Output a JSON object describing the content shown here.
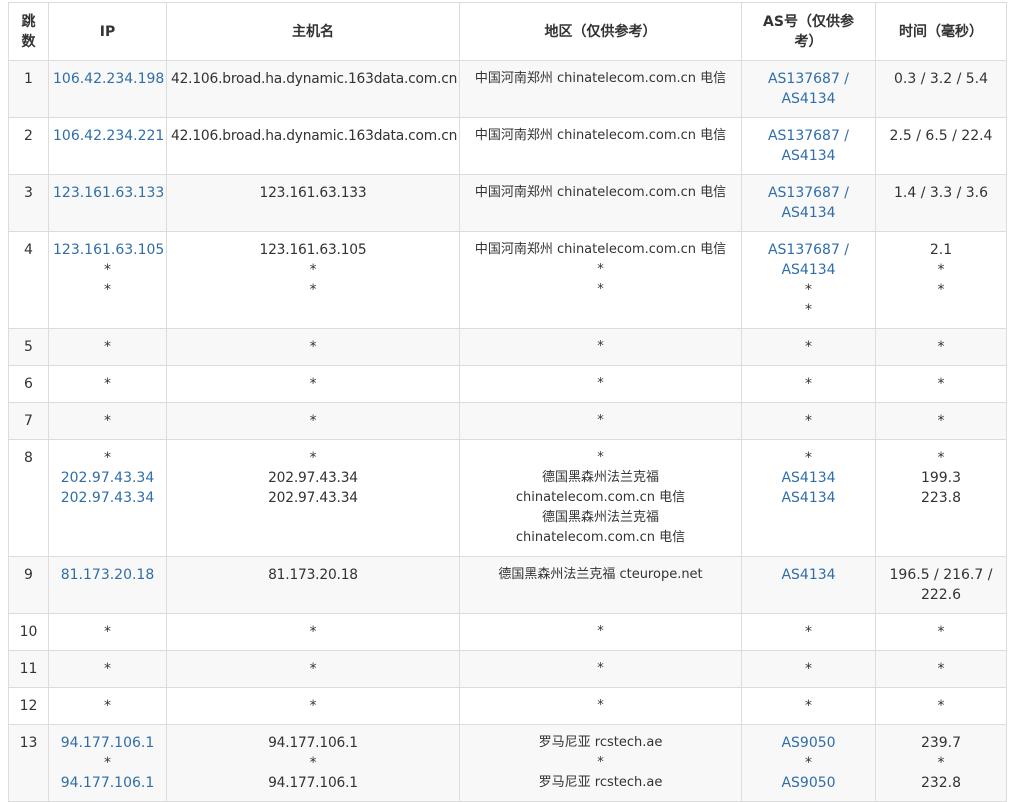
{
  "headers": {
    "hop": "跳数",
    "ip": "IP",
    "host": "主机名",
    "region": "地区（仅供参考）",
    "as": "AS号（仅供参考）",
    "time": "时间（毫秒）"
  },
  "rows": [
    {
      "hop": "1",
      "ip": [
        "106.42.234.198"
      ],
      "host": [
        "42.106.broad.ha.dynamic.163data.com.cn"
      ],
      "region": [
        "中国河南郑州 chinatelecom.com.cn 电信"
      ],
      "as": [
        "AS137687 /",
        "AS4134"
      ],
      "time": [
        "0.3 / 3.2 / 5.4"
      ]
    },
    {
      "hop": "2",
      "ip": [
        "106.42.234.221"
      ],
      "host": [
        "42.106.broad.ha.dynamic.163data.com.cn"
      ],
      "region": [
        "中国河南郑州 chinatelecom.com.cn 电信"
      ],
      "as": [
        "AS137687 /",
        "AS4134"
      ],
      "time": [
        "2.5 / 6.5 / 22.4"
      ]
    },
    {
      "hop": "3",
      "ip": [
        "123.161.63.133"
      ],
      "host": [
        "123.161.63.133"
      ],
      "region": [
        "中国河南郑州 chinatelecom.com.cn 电信"
      ],
      "as": [
        "AS137687 /",
        "AS4134"
      ],
      "time": [
        "1.4 / 3.3 / 3.6"
      ]
    },
    {
      "hop": "4",
      "ip": [
        "123.161.63.105",
        "*",
        "*"
      ],
      "host": [
        "123.161.63.105",
        "*",
        "*"
      ],
      "region": [
        "中国河南郑州 chinatelecom.com.cn 电信",
        "*",
        "*"
      ],
      "as": [
        "AS137687 /",
        "AS4134",
        "*",
        "*"
      ],
      "time": [
        "2.1",
        "*",
        "*"
      ]
    },
    {
      "hop": "5",
      "ip": [
        "*"
      ],
      "host": [
        "*"
      ],
      "region": [
        "*"
      ],
      "as": [
        "*"
      ],
      "time": [
        "*"
      ]
    },
    {
      "hop": "6",
      "ip": [
        "*"
      ],
      "host": [
        "*"
      ],
      "region": [
        "*"
      ],
      "as": [
        "*"
      ],
      "time": [
        "*"
      ]
    },
    {
      "hop": "7",
      "ip": [
        "*"
      ],
      "host": [
        "*"
      ],
      "region": [
        "*"
      ],
      "as": [
        "*"
      ],
      "time": [
        "*"
      ]
    },
    {
      "hop": "8",
      "ip": [
        "*",
        "202.97.43.34",
        "202.97.43.34"
      ],
      "host": [
        "*",
        "202.97.43.34",
        "202.97.43.34"
      ],
      "region": [
        "*",
        "德国黑森州法兰克福",
        "chinatelecom.com.cn 电信",
        "德国黑森州法兰克福",
        "chinatelecom.com.cn 电信"
      ],
      "as": [
        "*",
        "AS4134",
        "AS4134"
      ],
      "time": [
        "*",
        "199.3",
        "223.8"
      ]
    },
    {
      "hop": "9",
      "ip": [
        "81.173.20.18"
      ],
      "host": [
        "81.173.20.18"
      ],
      "region": [
        "德国黑森州法兰克福 cteurope.net"
      ],
      "as": [
        "AS4134"
      ],
      "time": [
        "196.5 / 216.7 /",
        "222.6"
      ]
    },
    {
      "hop": "10",
      "ip": [
        "*"
      ],
      "host": [
        "*"
      ],
      "region": [
        "*"
      ],
      "as": [
        "*"
      ],
      "time": [
        "*"
      ]
    },
    {
      "hop": "11",
      "ip": [
        "*"
      ],
      "host": [
        "*"
      ],
      "region": [
        "*"
      ],
      "as": [
        "*"
      ],
      "time": [
        "*"
      ]
    },
    {
      "hop": "12",
      "ip": [
        "*"
      ],
      "host": [
        "*"
      ],
      "region": [
        "*"
      ],
      "as": [
        "*"
      ],
      "time": [
        "*"
      ]
    },
    {
      "hop": "13",
      "ip": [
        "94.177.106.1",
        "*",
        "94.177.106.1"
      ],
      "host": [
        "94.177.106.1",
        "*",
        "94.177.106.1"
      ],
      "region": [
        "罗马尼亚 rcstech.ae",
        "*",
        "罗马尼亚 rcstech.ae"
      ],
      "as": [
        "AS9050",
        "*",
        "AS9050"
      ],
      "time": [
        "239.7",
        "*",
        "232.8"
      ]
    }
  ],
  "colors": {
    "link": "#2f6ea8",
    "border": "#dcdcdc",
    "stripe": "#f8f8f8",
    "text": "#333333"
  }
}
